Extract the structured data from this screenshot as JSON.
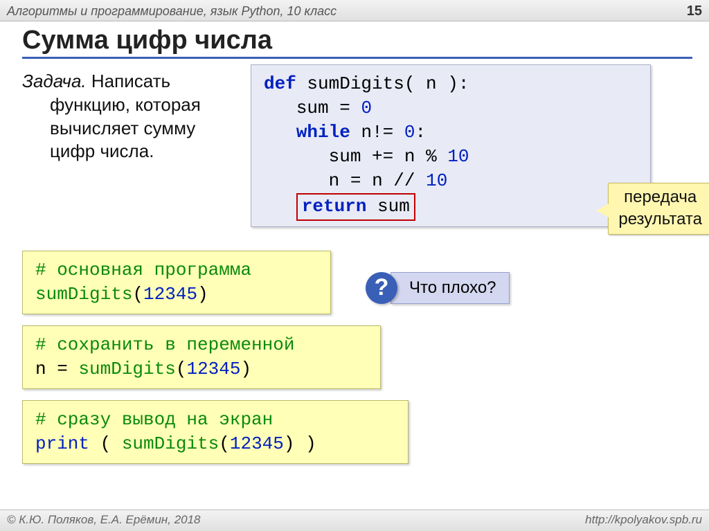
{
  "header": {
    "course": "Алгоритмы и программирование, язык Python, 10 класс",
    "page": "15"
  },
  "title": "Сумма цифр числа",
  "task": {
    "label": "Задача.",
    "body": "Написать функцию, которая вычисляет сумму цифр числа."
  },
  "code": {
    "l1_def": "def",
    "l1_fn": "sumDigits( n ):",
    "l2_a": "sum",
    "l2_b": "=",
    "l2_c": "0",
    "l3_a": "while",
    "l3_b": "n!=",
    "l3_c": "0",
    "l3_d": ":",
    "l4_a": "sum",
    "l4_b": "+=",
    "l4_c": "n",
    "l4_d": "%",
    "l4_e": "10",
    "l5_a": "n",
    "l5_b": "=",
    "l5_c": "n",
    "l5_d": "//",
    "l5_e": "10",
    "ret_a": "return",
    "ret_b": "sum"
  },
  "callout": {
    "line1": "передача",
    "line2": "результата"
  },
  "blocks": {
    "b1_comment": "# основная программа",
    "b1_fn": "sumDigits",
    "b1_open": "(",
    "b1_arg": "12345",
    "b1_close": ")",
    "b2_comment": "# сохранить в переменной",
    "b2_lhs": "n = ",
    "b2_fn": "sumDigits",
    "b2_open": "(",
    "b2_arg": "12345",
    "b2_close": ")",
    "b3_comment": "# сразу вывод на экран",
    "b3_pr": "print",
    "b3_o1": " ( ",
    "b3_fn": "sumDigits",
    "b3_o2": "(",
    "b3_arg": "12345",
    "b3_c2": ")",
    "b3_c1": " )"
  },
  "question": {
    "mark": "?",
    "text": "Что плохо?"
  },
  "footer": {
    "left": "© К.Ю. Поляков, Е.А. Ерёмин, 2018",
    "right": "http://kpolyakov.spb.ru"
  }
}
